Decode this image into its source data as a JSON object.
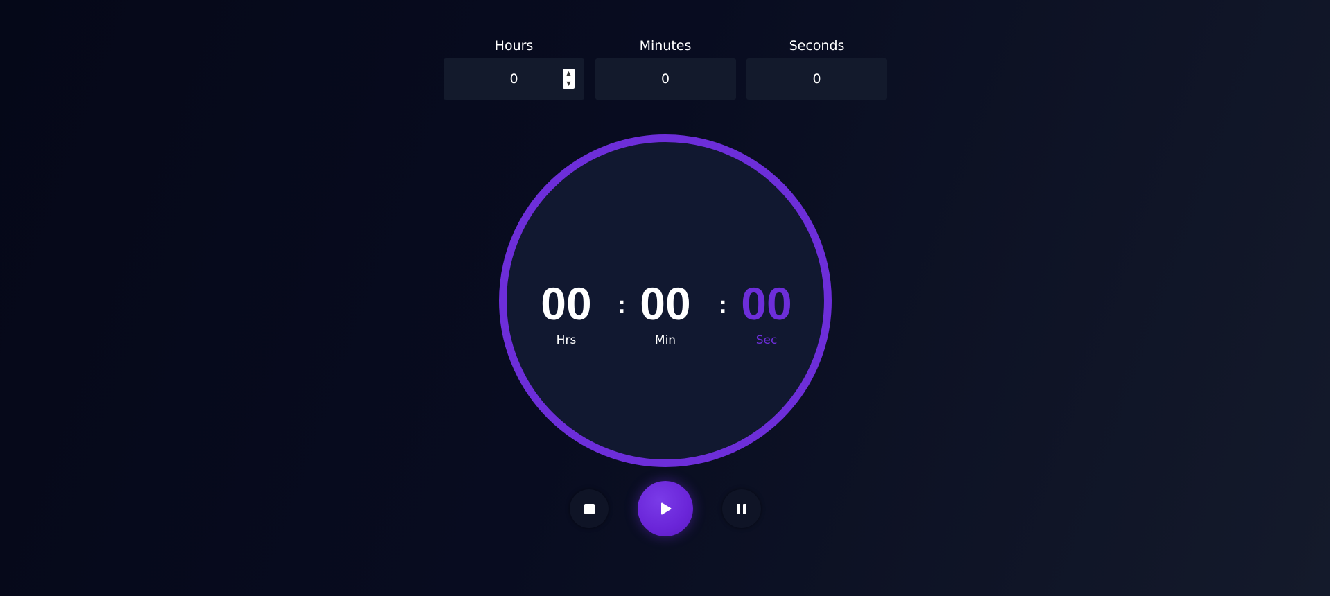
{
  "inputs": {
    "hours": {
      "label": "Hours",
      "value": "0"
    },
    "minutes": {
      "label": "Minutes",
      "value": "0"
    },
    "seconds": {
      "label": "Seconds",
      "value": "0"
    }
  },
  "display": {
    "hours": {
      "value": "00",
      "label": "Hrs"
    },
    "minutes": {
      "value": "00",
      "label": "Min"
    },
    "seconds": {
      "value": "00",
      "label": "Sec"
    },
    "separator": ":"
  },
  "controls": {
    "stop_icon": "stop-icon",
    "play_icon": "play-icon",
    "pause_icon": "pause-icon"
  },
  "colors": {
    "accent": "#6d2ed9",
    "background": "#080c20",
    "panel": "#111830",
    "text": "#ffffff"
  }
}
